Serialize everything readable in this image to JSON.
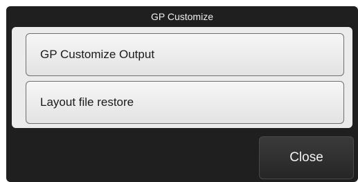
{
  "window": {
    "title": "GP Customize"
  },
  "menu": {
    "items": [
      {
        "label": "GP Customize Output"
      },
      {
        "label": "Layout file restore"
      }
    ]
  },
  "footer": {
    "close_label": "Close"
  },
  "colors": {
    "dialog_background": "#1f1f1f",
    "panel_background": "#ebebeb",
    "button_border": "#6f6f6f"
  }
}
